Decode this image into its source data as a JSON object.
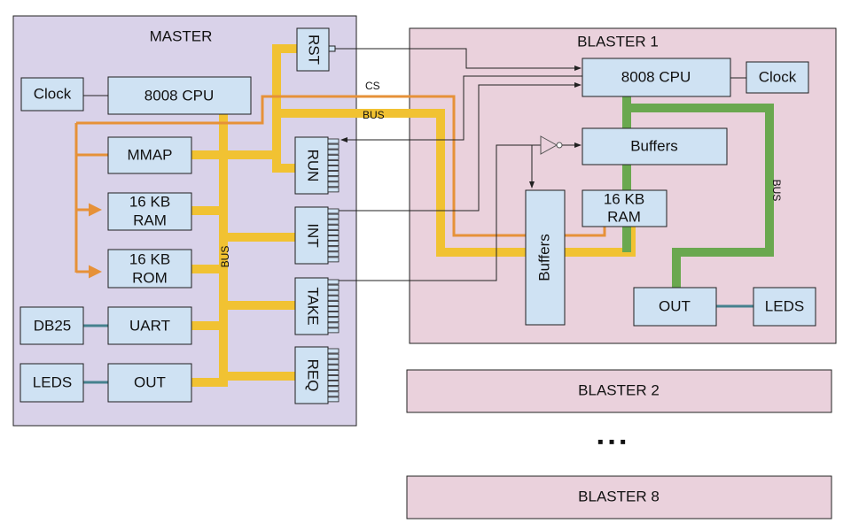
{
  "master": {
    "title": "MASTER",
    "clock": "Clock",
    "cpu": "8008 CPU",
    "mmap": "MMAP",
    "ram": [
      "16 KB",
      "RAM"
    ],
    "rom": [
      "16 KB",
      "ROM"
    ],
    "db25": "DB25",
    "uart": "UART",
    "leds": "LEDS",
    "out": "OUT",
    "bus_label": "BUS",
    "ports": {
      "rst": "RST",
      "run": "RUN",
      "int": "INT",
      "take": "TAKE",
      "req": "REQ"
    }
  },
  "links": {
    "cs_label": "CS",
    "bus_label": "BUS"
  },
  "blaster1": {
    "title": "BLASTER 1",
    "cpu": "8008 CPU",
    "clock": "Clock",
    "buffers_top": "Buffers",
    "ram": [
      "16 KB",
      "RAM"
    ],
    "buffers_side": "Buffers",
    "out": "OUT",
    "leds": "LEDS",
    "bus_label": "BUS"
  },
  "blaster2": {
    "title": "BLASTER 2"
  },
  "ellipsis": "▪ ▪ ▪",
  "blaster8": {
    "title": "BLASTER 8"
  },
  "colors": {
    "master_bg": "#d9d2e9",
    "blaster_bg": "#ead1dc",
    "box": "#cfe2f3",
    "bus": "#f1c232",
    "blaster_bus": "#6aa84f",
    "chip_select": "#e69138",
    "serial_link": "#45818e"
  }
}
